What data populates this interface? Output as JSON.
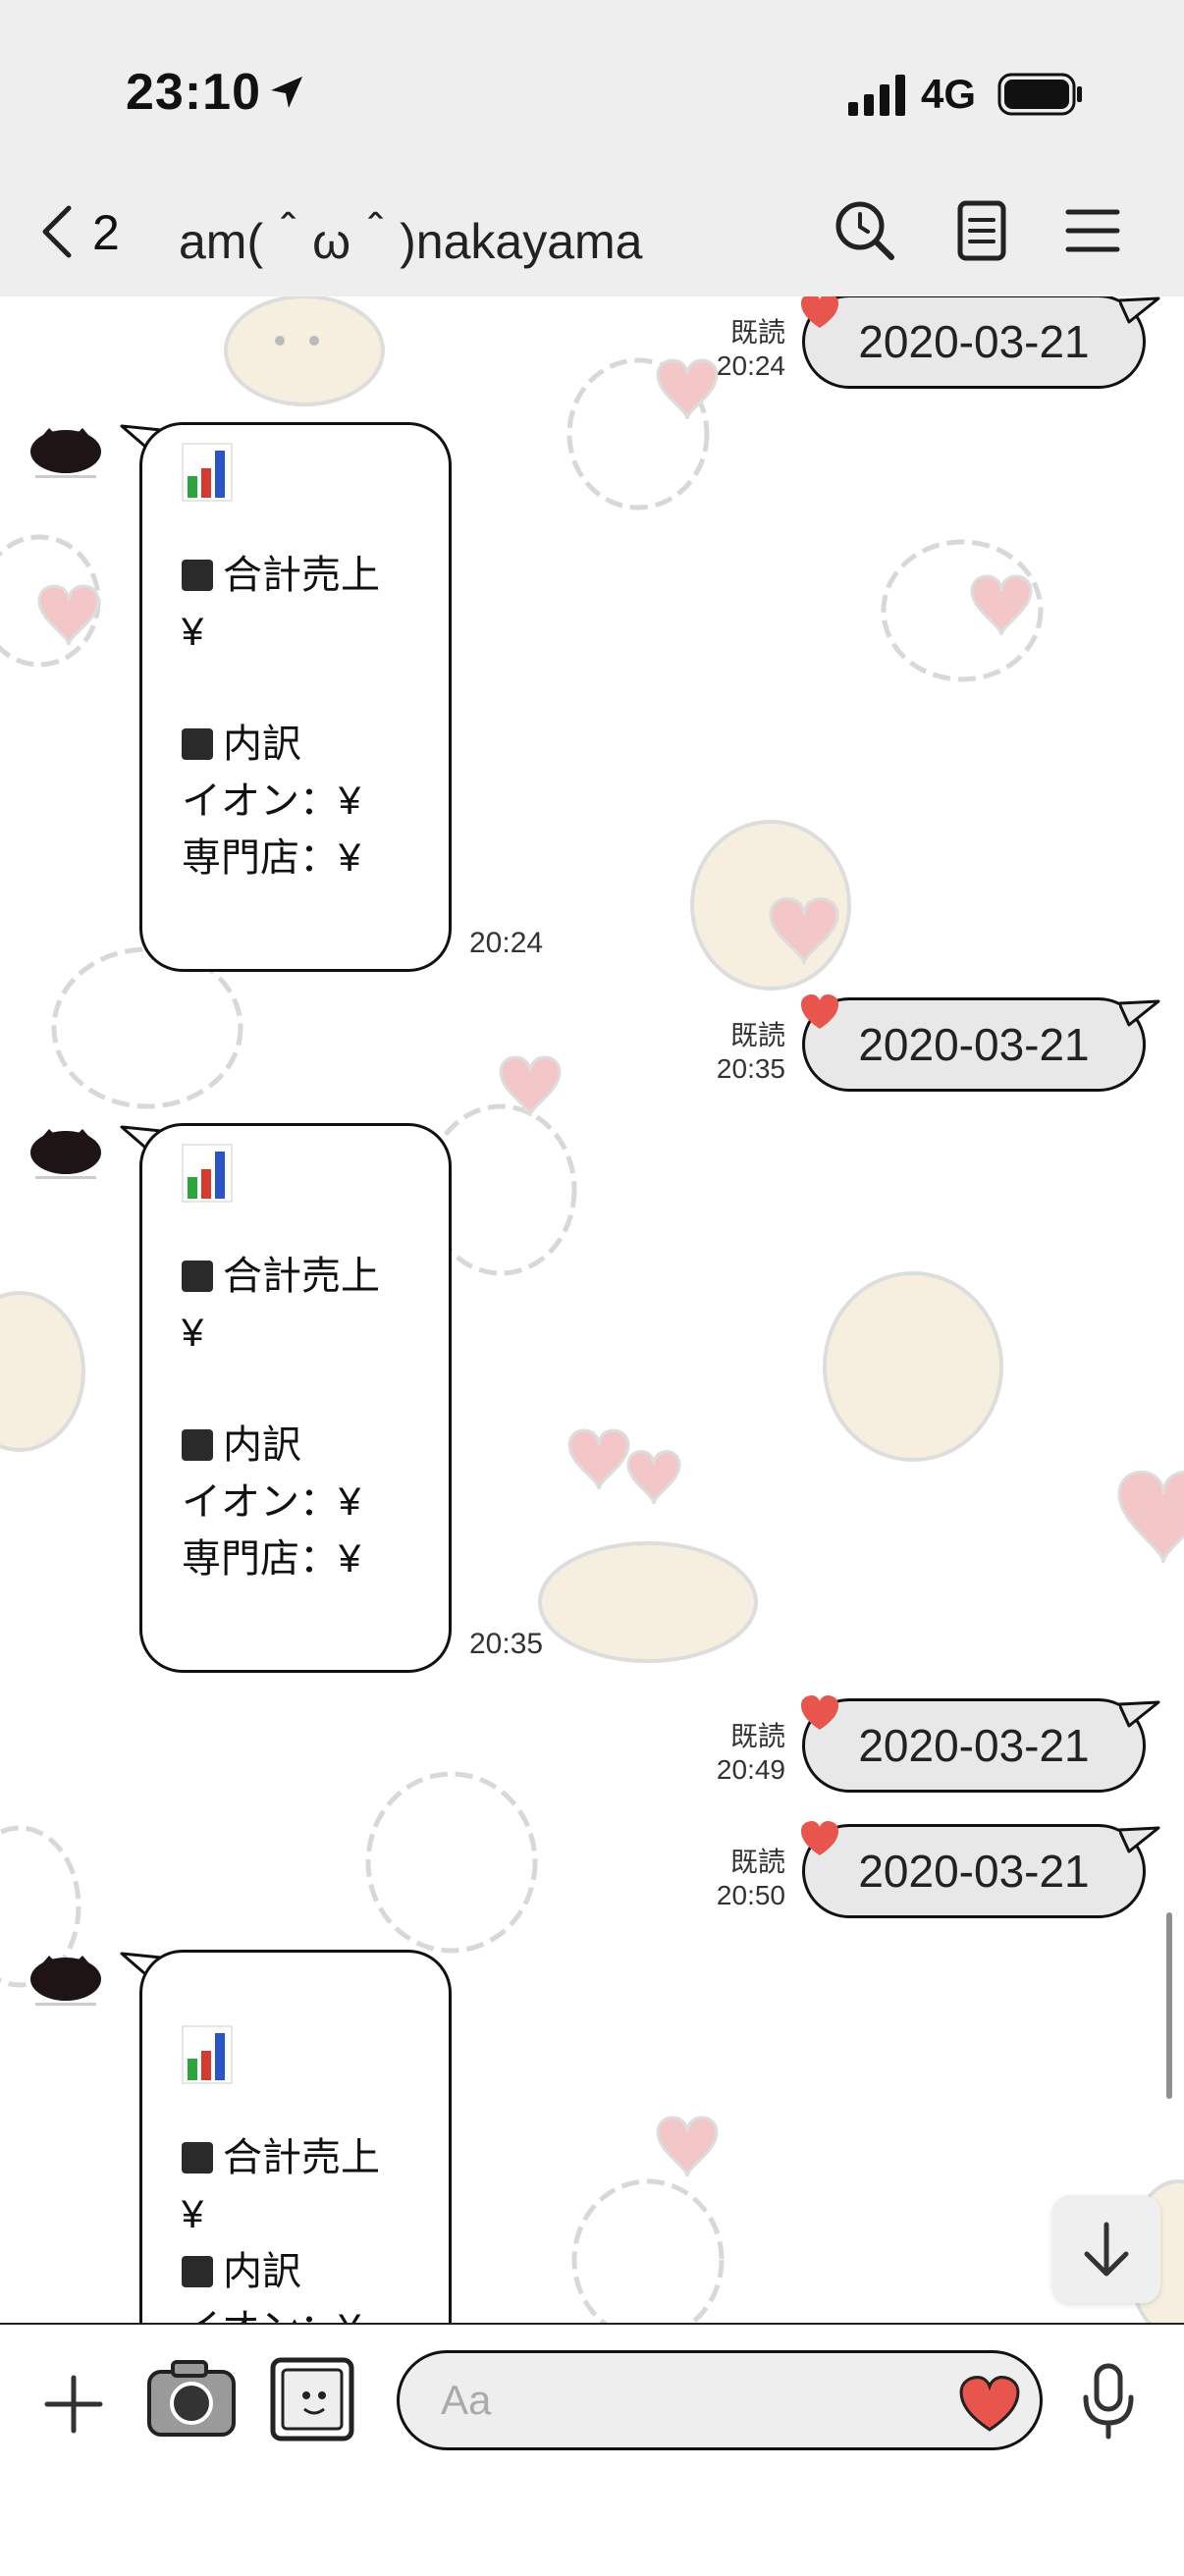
{
  "status_bar": {
    "time": "23:10",
    "network": "4G"
  },
  "header": {
    "back_count": "2",
    "title": "am(＾ω＾)nakayama"
  },
  "messages": [
    {
      "type": "out",
      "date": "2020-03-21",
      "read": "既読",
      "time": "20:24"
    },
    {
      "type": "in",
      "lines": [
        "合計売上",
        "¥",
        "内訳",
        "イオン：¥",
        "専門店：¥"
      ],
      "time": "20:24"
    },
    {
      "type": "out",
      "date": "2020-03-21",
      "read": "既読",
      "time": "20:35"
    },
    {
      "type": "in",
      "lines": [
        "合計売上",
        "¥",
        "内訳",
        "イオン：¥",
        "専門店：¥"
      ],
      "time": "20:35"
    },
    {
      "type": "out",
      "date": "2020-03-21",
      "read": "既読",
      "time": "20:49"
    },
    {
      "type": "out",
      "date": "2020-03-21",
      "read": "既読",
      "time": "20:50"
    },
    {
      "type": "in",
      "lines": [
        "合計売上",
        "¥",
        "内訳",
        "イオン：¥"
      ]
    }
  ],
  "input": {
    "placeholder": "Aa"
  },
  "icons": {
    "back": "chevron-left-icon",
    "search": "clock-search-icon",
    "notes": "notes-icon",
    "menu": "hamburger-menu-icon",
    "add": "plus-icon",
    "camera": "camera-icon",
    "gallery": "photo-icon",
    "emoji": "heart-icon",
    "voice": "microphone-icon",
    "scroll": "arrow-down-icon",
    "chart": "bar-chart-icon"
  },
  "colors": {
    "header_bg": "#eeeeee",
    "bubble_out_bg": "#e8e8e8",
    "heart": "#e8554d"
  }
}
